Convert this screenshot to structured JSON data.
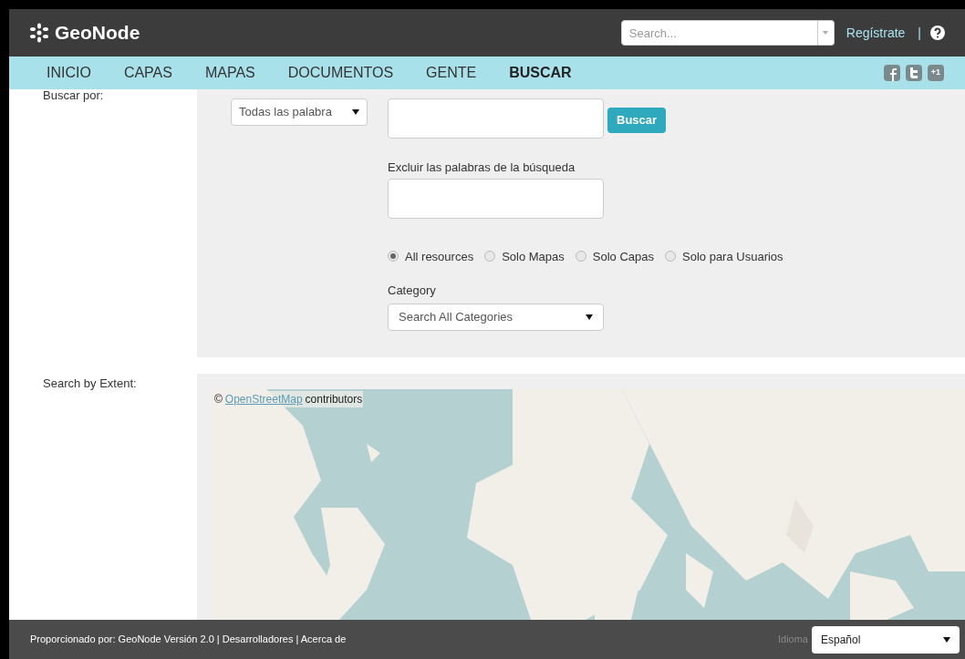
{
  "header": {
    "logo": "GeoNode",
    "search": {
      "placeholder": "Search..."
    },
    "register_link": "Regístrate",
    "separator": "|"
  },
  "nav": {
    "items": [
      {
        "label": "INICIO",
        "selected": false
      },
      {
        "label": "CAPAS",
        "selected": false
      },
      {
        "label": "MAPAS",
        "selected": false
      },
      {
        "label": "DOCUMENTOS",
        "selected": false
      },
      {
        "label": "GENTE",
        "selected": false
      },
      {
        "label": "BUSCAR",
        "selected": true
      }
    ],
    "social": [
      {
        "kind": "facebook"
      },
      {
        "kind": "twitter"
      },
      {
        "kind": "plusone",
        "label": "+1"
      }
    ]
  },
  "search_form": {
    "label": "Buscar por:",
    "match_select": "Todas las palabra",
    "search_button": "Buscar",
    "exclude_label": "Excluir las palabras de la búsqueda",
    "resource_types": [
      {
        "label": "All resources",
        "selected": true
      },
      {
        "label": "Solo Mapas",
        "selected": false
      },
      {
        "label": "Solo Capas",
        "selected": false
      },
      {
        "label": "Solo para Usuarios",
        "selected": false
      }
    ],
    "category_label": "Category",
    "category_select": "Search All Categories"
  },
  "extent": {
    "label": "Search by Extent:",
    "attribution_symbol": "©",
    "attribution_link": "OpenStreetMap",
    "attribution_text": "contributors"
  },
  "footer": {
    "credits": "Proporcionado por: GeoNode Versión 2.0 | Desarrolladores | Acerca de",
    "language_label": "Idioma",
    "language_select": "Español"
  }
}
